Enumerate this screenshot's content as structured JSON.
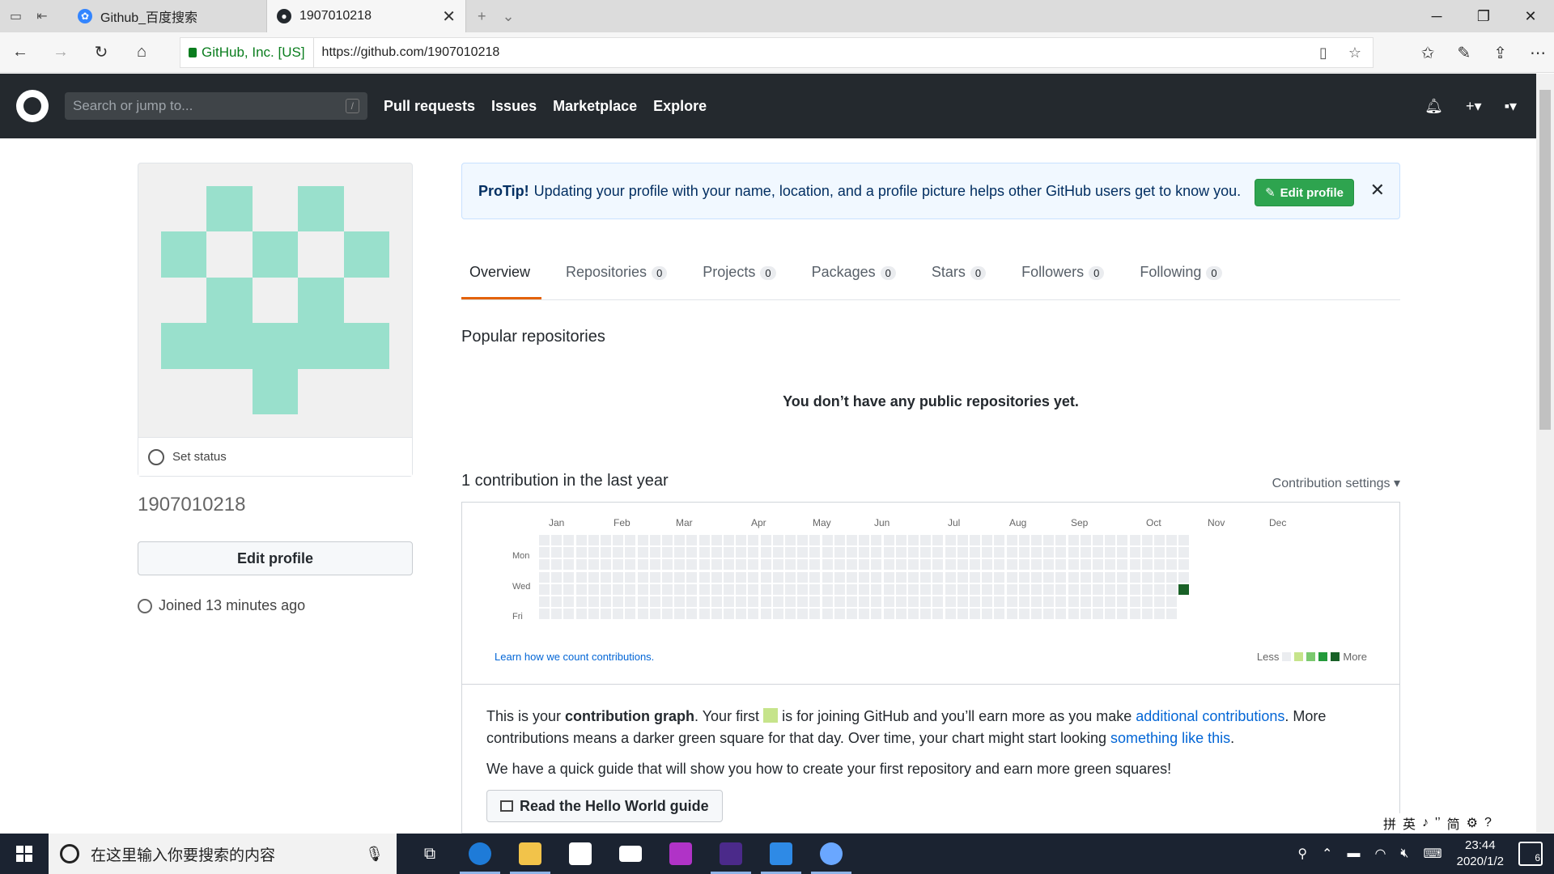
{
  "browser": {
    "tabs": [
      {
        "title": "Github_百度搜索",
        "favicon": "baidu-paw-icon",
        "active": false
      },
      {
        "title": "1907010218",
        "favicon": "github-octocat-icon",
        "active": true
      }
    ],
    "cert_label": "GitHub, Inc. [US]",
    "url": "https://github.com/1907010218"
  },
  "github_header": {
    "search_placeholder": "Search or jump to...",
    "search_shortcut": "/",
    "nav": [
      "Pull requests",
      "Issues",
      "Marketplace",
      "Explore"
    ]
  },
  "profile": {
    "set_status": "Set status",
    "username": "1907010218",
    "edit_profile": "Edit profile",
    "joined": "Joined 13 minutes ago",
    "avatar_color": "#99e0cc"
  },
  "protip": {
    "label": "ProTip!",
    "text": "Updating your profile with your name, location, and a profile picture helps other GitHub users get to know you.",
    "button": "Edit profile"
  },
  "tabs": [
    {
      "label": "Overview",
      "count": null
    },
    {
      "label": "Repositories",
      "count": "0"
    },
    {
      "label": "Projects",
      "count": "0"
    },
    {
      "label": "Packages",
      "count": "0"
    },
    {
      "label": "Stars",
      "count": "0"
    },
    {
      "label": "Followers",
      "count": "0"
    },
    {
      "label": "Following",
      "count": "0"
    }
  ],
  "popular": {
    "title": "Popular repositories",
    "empty": "You don’t have any public repositories yet."
  },
  "contributions": {
    "title": "1 contribution in the last year",
    "settings": "Contribution settings ▾",
    "months": [
      "Jan",
      "Feb",
      "Mar",
      "Apr",
      "May",
      "Jun",
      "Jul",
      "Aug",
      "Sep",
      "Oct",
      "Nov",
      "Dec"
    ],
    "days": [
      "Mon",
      "Wed",
      "Fri"
    ],
    "learn": "Learn how we count contributions.",
    "legend_less": "Less",
    "legend_more": "More",
    "legend_colors": [
      "#ebedf0",
      "#c6e48b",
      "#7bc96f",
      "#239a3b",
      "#196127"
    ]
  },
  "info": {
    "p1_a": "This is your ",
    "p1_b": "contribution graph",
    "p1_c": ". Your first ",
    "p1_d": " is for joining GitHub and you’ll earn more as you make ",
    "p1_link1": "additional contributions",
    "p1_e": ". More contributions means a darker green square for that day. Over time, your chart might start looking ",
    "p1_link2": "something like this",
    "p1_f": ".",
    "p2": "We have a quick guide that will show you how to create your first repository and earn more green squares!",
    "guide_button": "Read the Hello World guide"
  },
  "ime": [
    "拼",
    "英",
    "♪",
    "'’",
    "简",
    "⚙",
    "?"
  ],
  "taskbar": {
    "search_placeholder": "在这里输入你要搜索的内容",
    "time": "23:44",
    "date": "2020/1/2",
    "notification_count": "6"
  }
}
